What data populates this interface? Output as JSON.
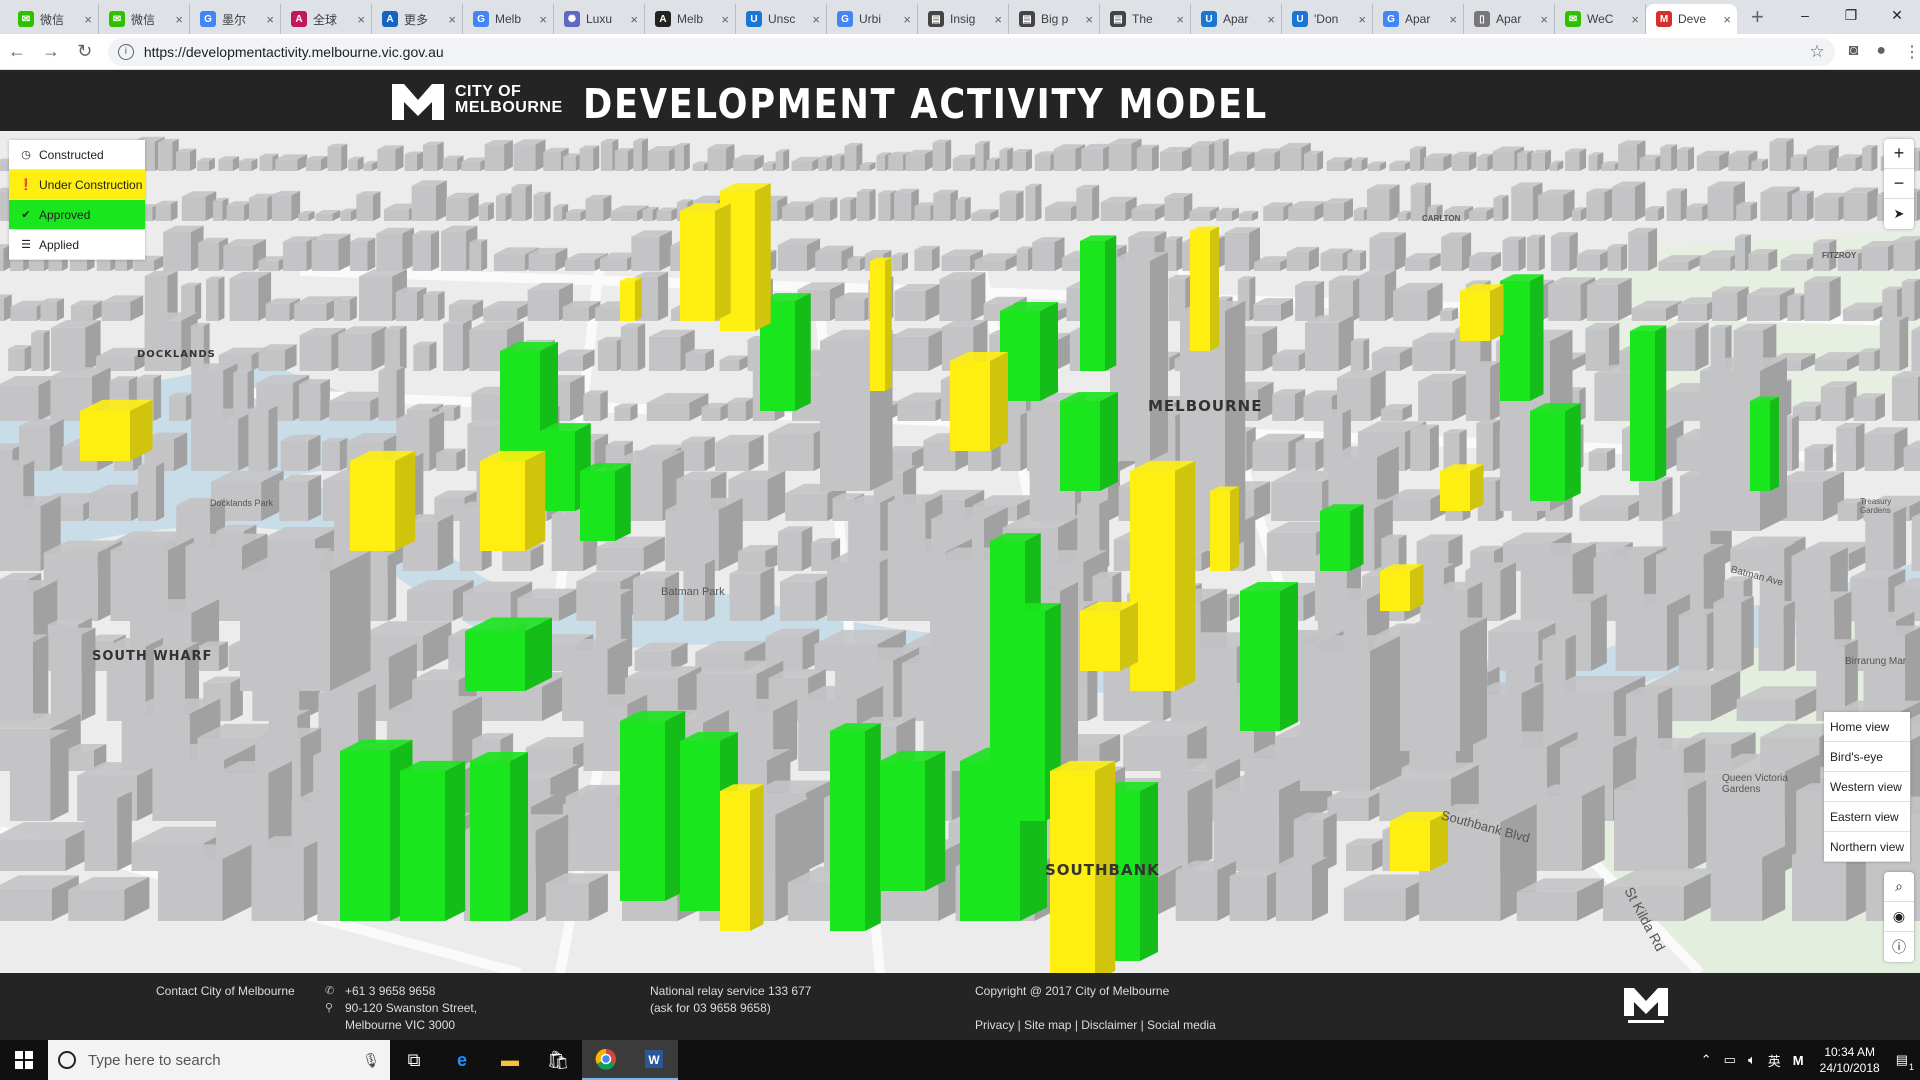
{
  "browser": {
    "tabs": [
      {
        "title": "微信",
        "icon": "wechat-icon",
        "color": "#2dc100",
        "glyph": "✉"
      },
      {
        "title": "微信",
        "icon": "wechat-icon",
        "color": "#2dc100",
        "glyph": "✉"
      },
      {
        "title": "墨尔",
        "icon": "google-icon",
        "color": "#4285f4",
        "glyph": "G"
      },
      {
        "title": "全球",
        "icon": "a-logo-icon",
        "color": "#c2185b",
        "glyph": "A"
      },
      {
        "title": "更多",
        "icon": "afr-icon",
        "color": "#1565c0",
        "glyph": "A"
      },
      {
        "title": "Melb",
        "icon": "google-icon",
        "color": "#4285f4",
        "glyph": "G"
      },
      {
        "title": "Luxu",
        "icon": "spinner-icon",
        "color": "#5c6bc0",
        "glyph": "✺"
      },
      {
        "title": "Melb",
        "icon": "a-logo-icon",
        "color": "#222222",
        "glyph": "A"
      },
      {
        "title": "Unsc",
        "icon": "urbis-icon",
        "color": "#1976d2",
        "glyph": "U"
      },
      {
        "title": "Urbi",
        "icon": "google-icon",
        "color": "#4285f4",
        "glyph": "G"
      },
      {
        "title": "Insig",
        "icon": "document-icon",
        "color": "#444444",
        "glyph": "▤"
      },
      {
        "title": "Big p",
        "icon": "document-icon",
        "color": "#444444",
        "glyph": "▤"
      },
      {
        "title": "The",
        "icon": "document-icon",
        "color": "#444444",
        "glyph": "▤"
      },
      {
        "title": "Apar",
        "icon": "urbis-icon",
        "color": "#1976d2",
        "glyph": "U"
      },
      {
        "title": "'Don",
        "icon": "urbis-icon",
        "color": "#1976d2",
        "glyph": "U"
      },
      {
        "title": "Apar",
        "icon": "google-icon",
        "color": "#4285f4",
        "glyph": "G"
      },
      {
        "title": "Apar",
        "icon": "file-icon",
        "color": "#777777",
        "glyph": "▯"
      },
      {
        "title": "WeC",
        "icon": "wechat-icon",
        "color": "#2dc100",
        "glyph": "✉"
      },
      {
        "title": "Deve",
        "icon": "melbourne-icon",
        "color": "#d32f2f",
        "glyph": "M"
      }
    ],
    "new_tab": "+",
    "url": "https://developmentactivity.melbourne.vic.gov.au"
  },
  "header": {
    "logo_line1": "CITY OF",
    "logo_line2": "MELBOURNE",
    "title": "DEVELOPMENT ACTIVITY MODEL"
  },
  "legend": {
    "constructed": "Constructed",
    "under_construction": "Under Construction",
    "approved": "Approved",
    "applied": "Applied"
  },
  "colors": {
    "under_construction": "#ffef10",
    "approved": "#19e61d",
    "building_gray": "#c4c4c6",
    "water": "#c9dde9"
  },
  "views": {
    "home": "Home view",
    "birds_eye": "Bird's-eye",
    "western": "Western view",
    "eastern": "Eastern view",
    "northern": "Northern view"
  },
  "map_labels": {
    "docklands": "DOCKLANDS",
    "melbourne": "MELBOURNE",
    "south_wharf": "SOUTH WHARF",
    "southbank": "SOUTHBANK",
    "batman_park": "Batman Park",
    "fitzroy": "FITZROY",
    "carlton": "CARLTON",
    "southbank_blvd": "Southbank Blvd",
    "st_kilda_rd": "St Kilda Rd",
    "queen_victoria_gardens": "Queen Victoria Gardens",
    "batman_ave": "Batman Ave",
    "birrarung_mar": "Birrarung Mar",
    "treasury_gardens": "Treasury Gardens",
    "docklands_park": "Docklands Park",
    "mapbox": "mapbox"
  },
  "footer": {
    "contact": "Contact City of Melbourne",
    "phone": "+61 3 9658 9658",
    "address1": "90-120 Swanston Street,",
    "address2": "Melbourne VIC 3000",
    "relay1": "National relay service 133 677",
    "relay2": "(ask for 03 9658 9658)",
    "copyright": "Copyright @ 2017 City of Melbourne",
    "links": "Privacy | Site map | Disclaimer | Social media"
  },
  "taskbar": {
    "search_placeholder": "Type here to search",
    "time": "10:34 AM",
    "date": "24/10/2018",
    "ime": "英",
    "notification_count": "1"
  }
}
